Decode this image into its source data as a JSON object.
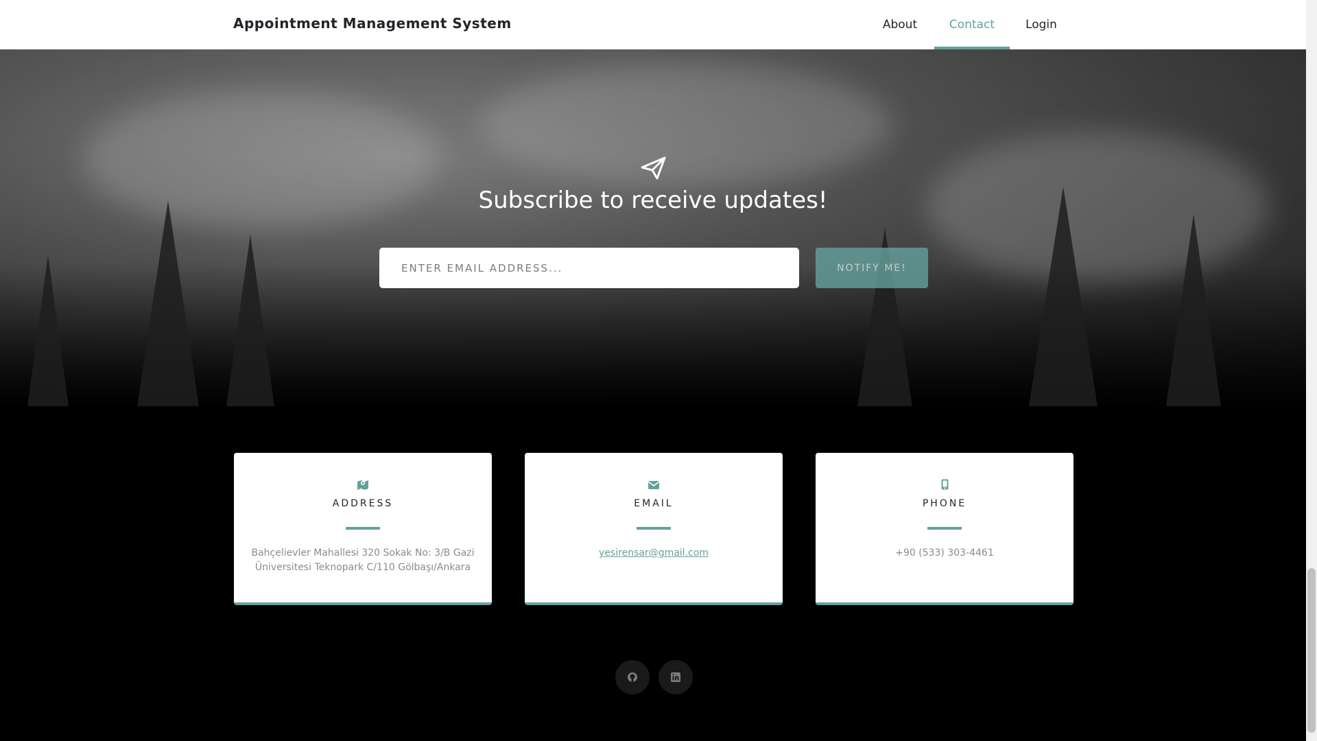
{
  "navbar": {
    "brand": "Appointment Management System",
    "links": [
      {
        "label": "About",
        "active": false
      },
      {
        "label": "Contact",
        "active": true
      },
      {
        "label": "Login",
        "active": false
      }
    ]
  },
  "signup": {
    "icon": "paper-plane-icon",
    "title": "Subscribe to receive updates!",
    "email_placeholder": "ENTER EMAIL ADDRESS...",
    "email_value": "",
    "button_label": "NOTIFY ME!"
  },
  "contact": {
    "cards": [
      {
        "icon": "map-icon",
        "title": "ADDRESS",
        "text": "Bahçelievler Mahallesi 320 Sokak No: 3/B Gazi Üniversitesi Teknopark C/110 Gölbaşı/Ankara"
      },
      {
        "icon": "envelope-icon",
        "title": "EMAIL",
        "text": "yesirensar@gmail.com"
      },
      {
        "icon": "mobile-phone-icon",
        "title": "PHONE",
        "text": "+90 (533) 303-4461"
      }
    ]
  },
  "social": [
    {
      "icon": "github-icon"
    },
    {
      "icon": "linkedin-icon"
    }
  ],
  "colors": {
    "accent": "#64a19d",
    "background": "#000000",
    "navbar": "#ffffff"
  }
}
